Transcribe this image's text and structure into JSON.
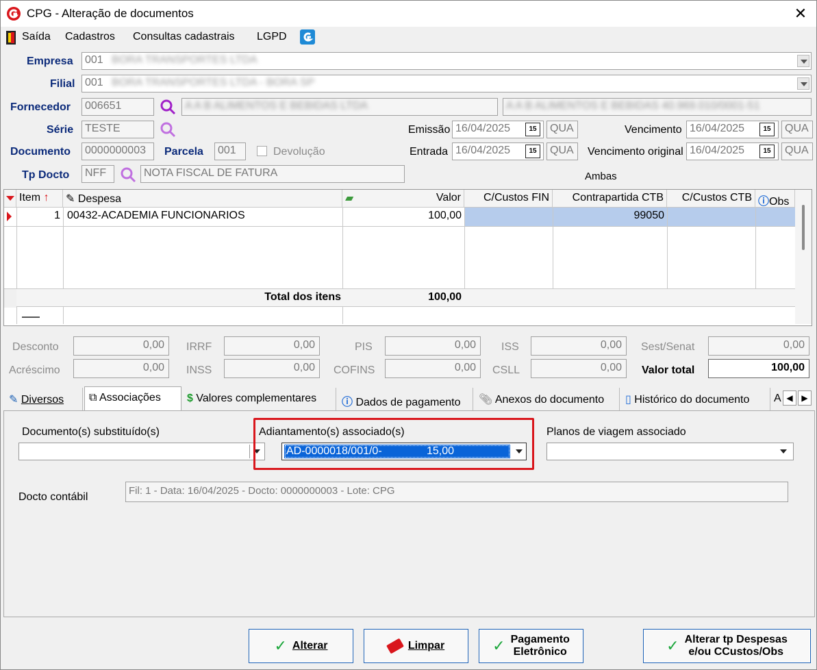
{
  "window": {
    "title": "CPG - Alteração de documentos",
    "close": "✕"
  },
  "menu": {
    "items": [
      "Saída",
      "Cadastros",
      "Consultas cadastrais",
      "LGPD"
    ]
  },
  "form": {
    "empresa_label": "Empresa",
    "empresa_code": "001",
    "empresa_name": "BORA TRANSPORTES LTDA",
    "filial_label": "Filial",
    "filial_code": "001",
    "filial_name": "BORA TRANSPORTES LTDA - BORA SP",
    "fornecedor_label": "Fornecedor",
    "fornecedor_code": "006651",
    "fornecedor_name": "A A B ALIMENTOS E BEBIDAS LTDA",
    "fornecedor_extra": "A A B ALIMENTOS E BEBIDAS   40.969.010/0001-51",
    "serie_label": "Série",
    "serie_value": "TESTE",
    "documento_label": "Documento",
    "documento_value": "0000000003",
    "parcela_label": "Parcela",
    "parcela_value": "001",
    "devolucao_label": "Devolução",
    "tpdocto_label": "Tp Docto",
    "tpdocto_code": "NFF",
    "tpdocto_name": "NOTA FISCAL DE FATURA",
    "emissao_label": "Emissão",
    "emissao_value": "16/04/2025",
    "emissao_day": "QUA",
    "entrada_label": "Entrada",
    "entrada_value": "16/04/2025",
    "entrada_day": "QUA",
    "vencimento_label": "Vencimento",
    "vencimento_value": "16/04/2025",
    "vencimento_day": "QUA",
    "venc_orig_label": "Vencimento original",
    "venc_orig_value": "16/04/2025",
    "venc_orig_day": "QUA",
    "ambas_label": "Ambas",
    "cal_icon_text": "15"
  },
  "grid": {
    "headers": [
      "Item",
      "Despesa",
      "Valor",
      "C/Custos FIN",
      "Contrapartida CTB",
      "C/Custos CTB",
      "Obs"
    ],
    "rows": [
      {
        "item": "1",
        "despesa": "00432-ACADEMIA FUNCIONARIOS",
        "valor": "100,00",
        "ccfin": "",
        "contrapartida": "99050",
        "ccctb": ""
      }
    ],
    "total_label": "Total dos itens",
    "total_value": "100,00"
  },
  "taxes": {
    "desconto_label": "Desconto",
    "desconto": "0,00",
    "acrescimo_label": "Acréscimo",
    "acrescimo": "0,00",
    "irrf_label": "IRRF",
    "irrf": "0,00",
    "inss_label": "INSS",
    "inss": "0,00",
    "pis_label": "PIS",
    "pis": "0,00",
    "cofins_label": "COFINS",
    "cofins": "0,00",
    "iss_label": "ISS",
    "iss": "0,00",
    "csll_label": "CSLL",
    "csll": "0,00",
    "sest_label": "Sest/Senat",
    "sest": "0,00",
    "valor_total_label": "Valor total",
    "valor_total": "100,00"
  },
  "tabs": [
    "Diversos",
    "Associações",
    "Valores complementares",
    "Dados de pagamento",
    "Anexos do documento",
    "Histórico do documento",
    "A"
  ],
  "assoc": {
    "substituidos_label": "Documento(s) substituído(s)",
    "adiantamento_label": "Adiantamento(s) associado(s)",
    "adiantamento_value": "AD-0000018/001/0-",
    "adiantamento_amount": "15,00",
    "planos_label": "Planos de viagem associado",
    "docto_contabil_label": "Docto contábil",
    "docto_contabil_value": "Fil: 1 - Data: 16/04/2025 - Docto: 0000000003 - Lote: CPG"
  },
  "buttons": {
    "alterar": "Alterar",
    "limpar": "Limpar",
    "pagamento_1": "Pagamento",
    "pagamento_2": "Eletrônico",
    "alterar_tp_1": "Alterar tp Despesas",
    "alterar_tp_2": "e/ou CCustos/Obs"
  },
  "colors": {
    "selection": "#0a64d8",
    "highlight_border": "#d9161c",
    "label_blue": "#0b2a7a",
    "row_blue": "#b6ccec"
  }
}
